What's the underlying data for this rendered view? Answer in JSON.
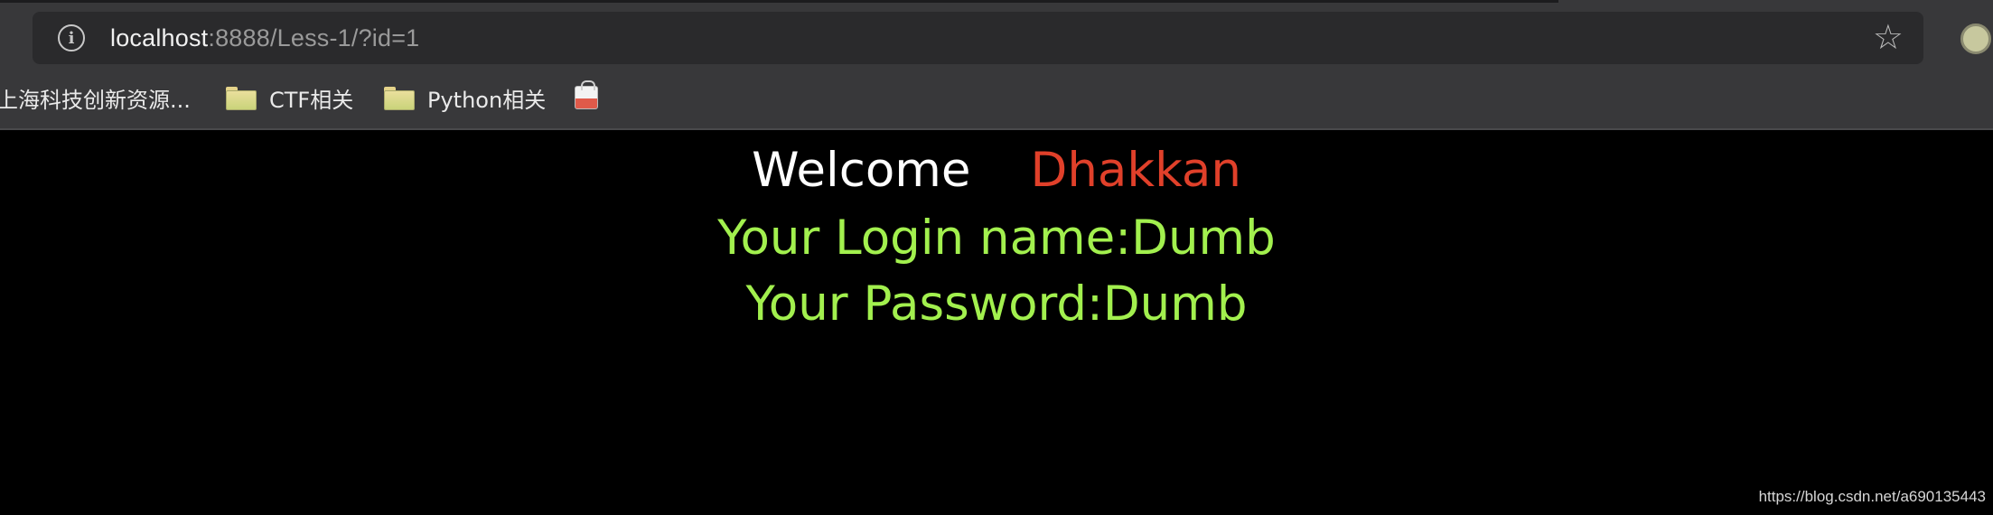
{
  "browser": {
    "url_host": "localhost",
    "url_rest": ":8888/Less-1/?id=1",
    "bookmarks": [
      {
        "label": "上海科技创新资源...",
        "icon": "none"
      },
      {
        "label": "CTF相关",
        "icon": "folder-icon"
      },
      {
        "label": "Python相关",
        "icon": "folder-icon"
      },
      {
        "label": "",
        "icon": "shopping-bag-icon"
      }
    ],
    "colors": {
      "toolbar": "#38383a",
      "address_bar": "#2a2a2c"
    }
  },
  "page": {
    "welcome_word": "Welcome",
    "welcome_name": "Dhakkan",
    "login_line": "Your Login name:Dumb",
    "password_line": "Your Password:Dumb",
    "colors": {
      "welcome": "#ffffff",
      "name": "#e0402a",
      "info": "#a2f04e",
      "background": "#000000"
    }
  },
  "watermark": "https://blog.csdn.net/a690135443"
}
